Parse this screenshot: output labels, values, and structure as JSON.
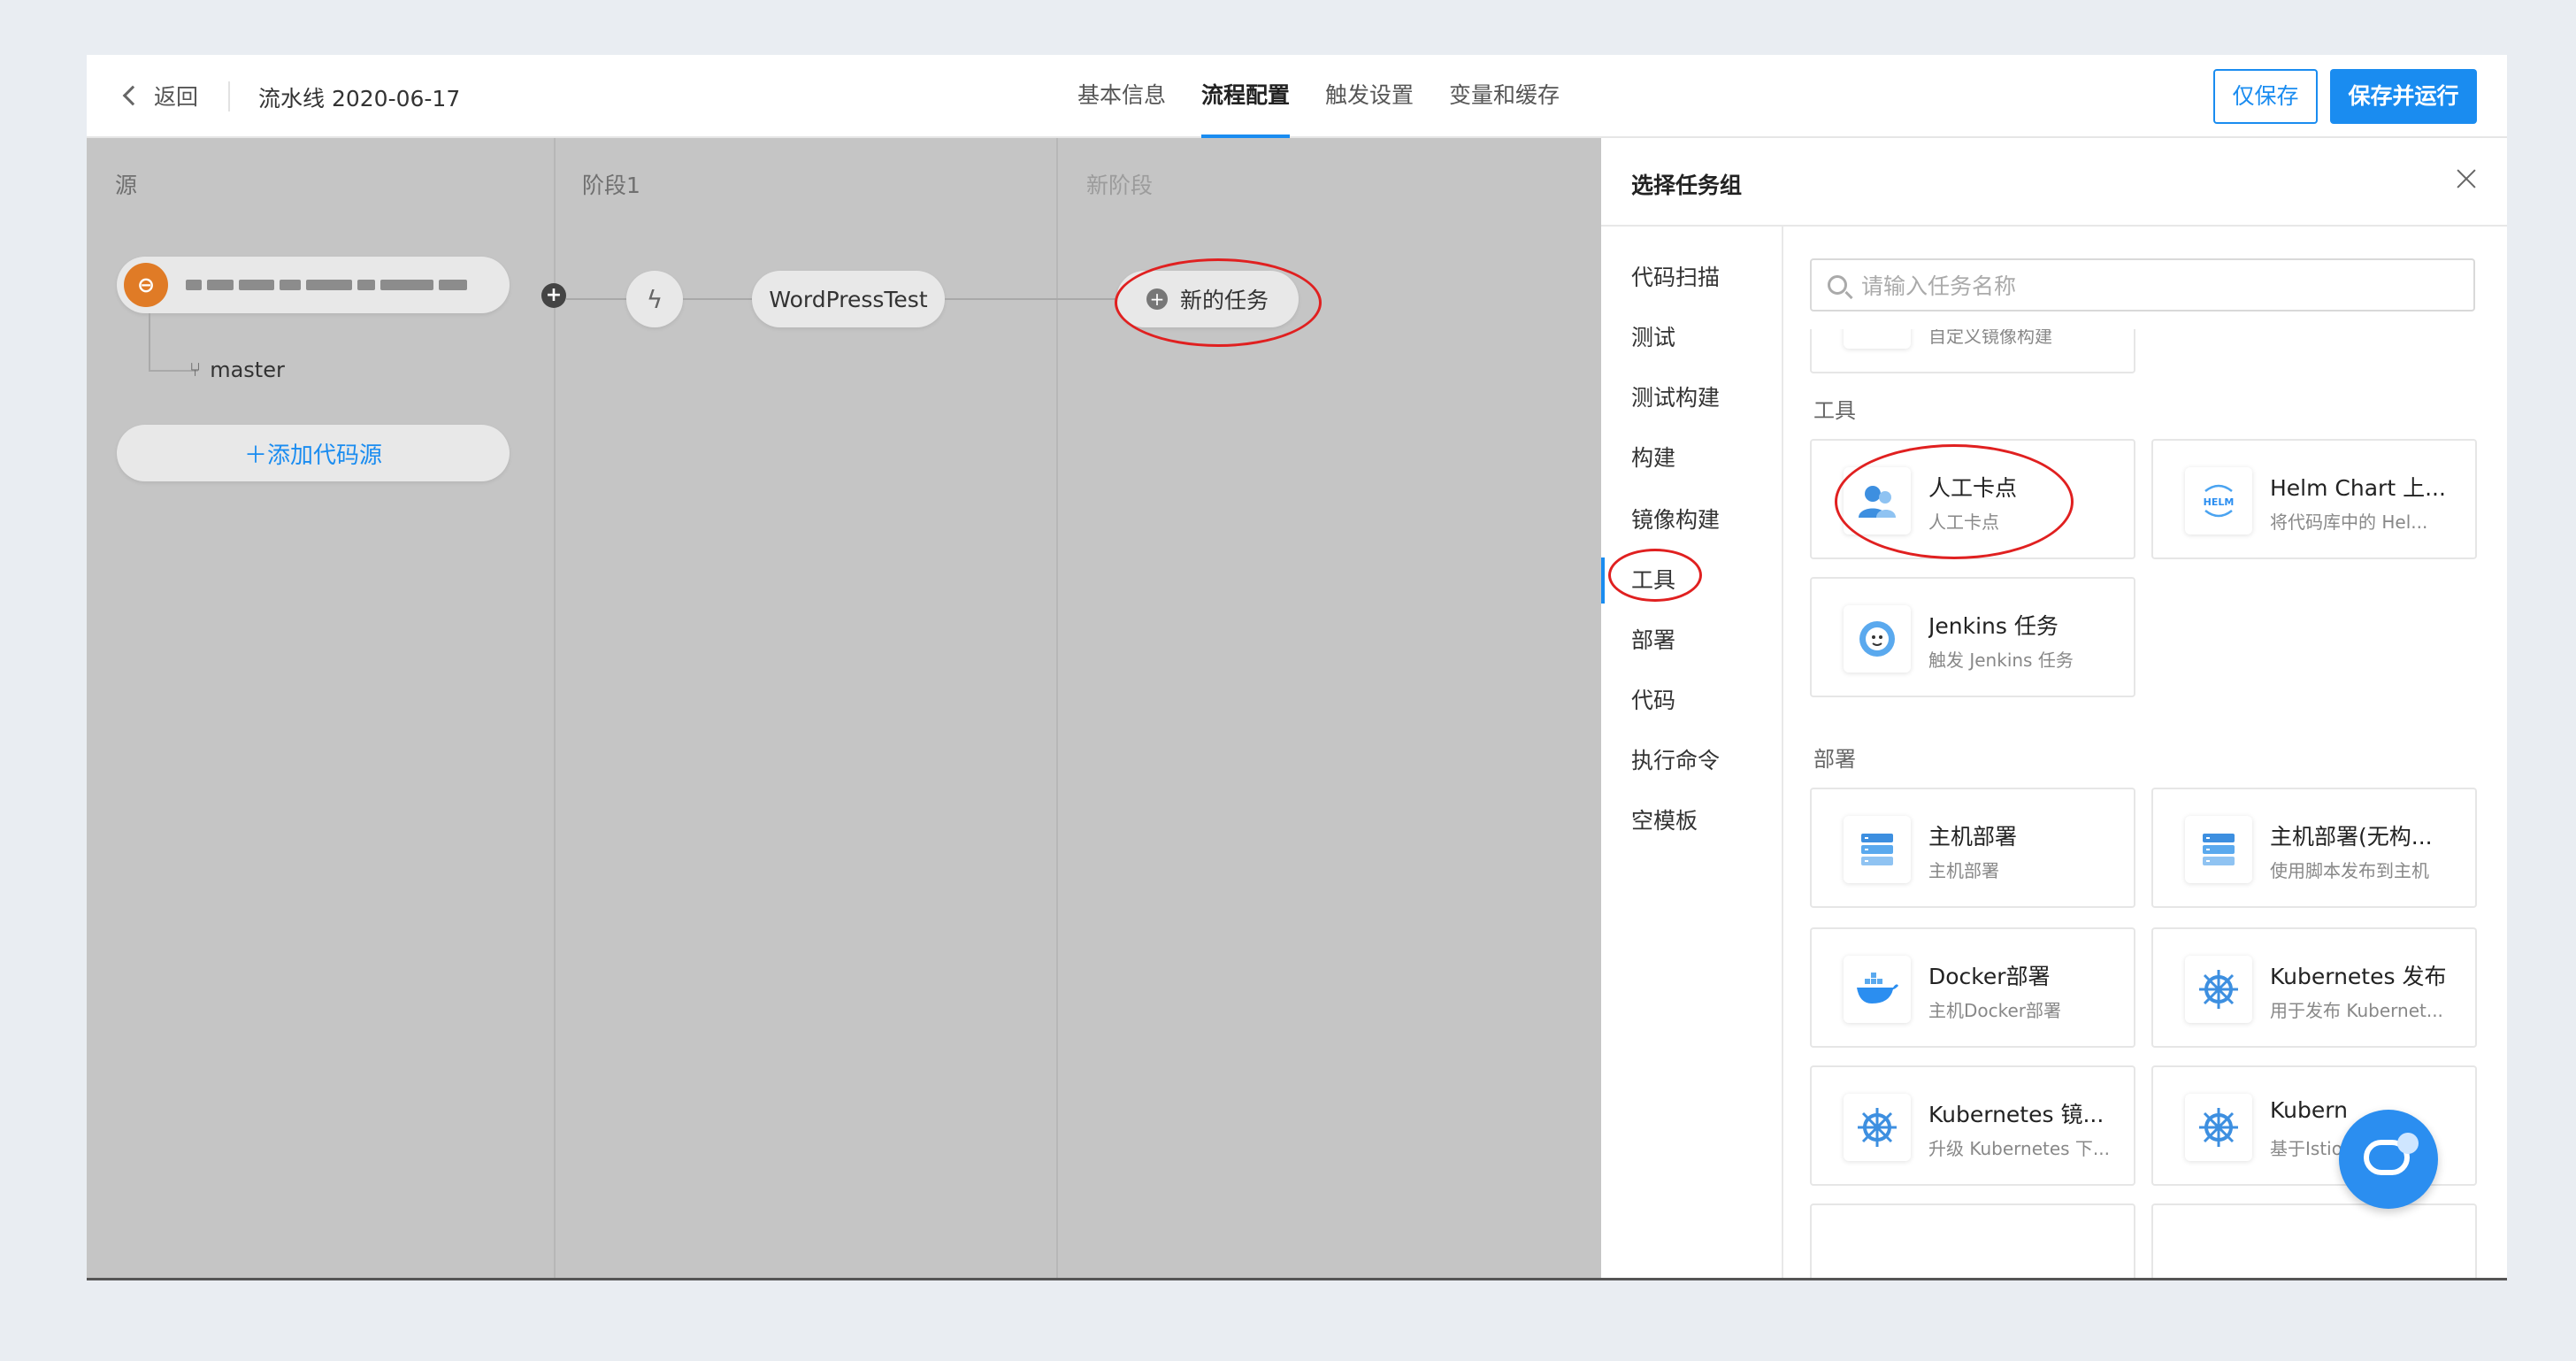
{
  "header": {
    "back_label": "返回",
    "pipeline_name": "流水线 2020-06-17",
    "tabs": [
      "基本信息",
      "流程配置",
      "触发设置",
      "变量和缓存"
    ],
    "active_tab": "流程配置",
    "save_label": "仅保存",
    "save_run_label": "保存并运行"
  },
  "canvas": {
    "columns": [
      "源",
      "阶段1",
      "新阶段"
    ],
    "source": {
      "branch": "master",
      "add_label": "＋添加代码源"
    },
    "job_name": "WordPressTest",
    "new_task_label": "新的任务"
  },
  "drawer": {
    "title": "选择任务组",
    "search_placeholder": "请输入任务名称",
    "categories": [
      "代码扫描",
      "测试",
      "测试构建",
      "构建",
      "镜像构建",
      "工具",
      "部署",
      "代码",
      "执行命令",
      "空模板"
    ],
    "active_category": "工具",
    "partial_card_desc": "自定义镜像构建",
    "sections": [
      {
        "title": "工具",
        "cards": [
          {
            "title": "人工卡点",
            "desc": "人工卡点",
            "icon": "user-icon"
          },
          {
            "title": "Helm Chart 上...",
            "desc": "将代码库中的 Hel...",
            "icon": "helm-icon"
          },
          {
            "title": "Jenkins 任务",
            "desc": "触发 Jenkins 任务",
            "icon": "jenkins-icon"
          }
        ]
      },
      {
        "title": "部署",
        "cards": [
          {
            "title": "主机部署",
            "desc": "主机部署",
            "icon": "server-icon"
          },
          {
            "title": "主机部署(无构...",
            "desc": "使用脚本发布到主机",
            "icon": "server-icon"
          },
          {
            "title": "Docker部署",
            "desc": "主机Docker部署",
            "icon": "docker-icon"
          },
          {
            "title": "Kubernetes 发布",
            "desc": "用于发布 Kubernet...",
            "icon": "kubernetes-icon"
          },
          {
            "title": "Kubernetes 镜...",
            "desc": "升级 Kubernetes 下...",
            "icon": "kubernetes-icon"
          },
          {
            "title": "Kubern",
            "desc": "基于Istio",
            "icon": "kubernetes-icon"
          }
        ]
      }
    ]
  },
  "colors": {
    "accent": "#1a8cf0",
    "annotation": "#e02020",
    "source_icon": "#e07b26"
  }
}
